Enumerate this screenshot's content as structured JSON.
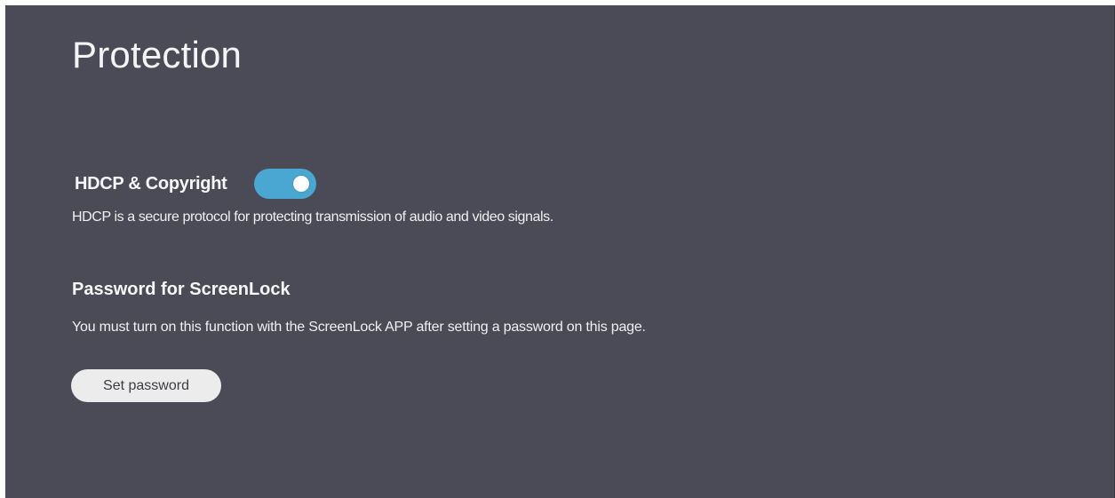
{
  "page": {
    "title": "Protection"
  },
  "hdcp": {
    "label": "HDCP & Copyright",
    "toggle_on": true,
    "toggle_color": "#4aa7d2",
    "description": "HDCP is a secure protocol for protecting transmission of audio and video signals."
  },
  "screenlock": {
    "heading": "Password for ScreenLock",
    "description": "You must turn on this function with the ScreenLock APP after setting a password on this page.",
    "button_label": "Set password"
  },
  "colors": {
    "background": "#4a4b56",
    "button_background": "#ececec"
  }
}
